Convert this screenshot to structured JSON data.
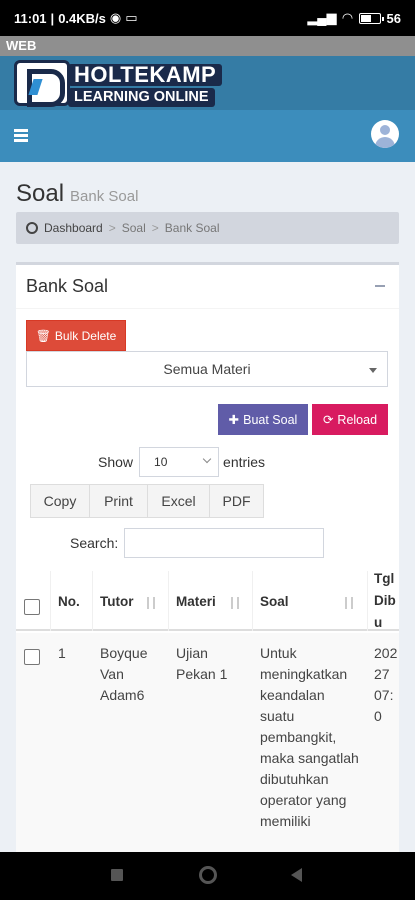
{
  "status_bar": {
    "time": "11:01",
    "speed": "0.4KB/s",
    "battery": "56",
    "battery_level": 0.56
  },
  "web_label": "WEB",
  "brand": {
    "line1": "HOLTEKAMP",
    "line2": "LEARNING ONLINE"
  },
  "header": {
    "title": "Soal",
    "subtitle": "Bank Soal"
  },
  "breadcrumb": {
    "items": [
      "Dashboard",
      "Soal",
      "Bank Soal"
    ]
  },
  "box": {
    "title": "Bank Soal",
    "bulk_delete": "Bulk Delete",
    "materi_select": "Semua Materi",
    "buat_soal": "Buat Soal",
    "reload": "Reload"
  },
  "datatable": {
    "show_label": "Show",
    "length_value": "10",
    "entries_label": "entries",
    "buttons": [
      "Copy",
      "Print",
      "Excel",
      "PDF"
    ],
    "search_label": "Search:",
    "columns": [
      "No.",
      "Tutor",
      "Materi",
      "Soal",
      "Tgl Dibu"
    ],
    "rows": [
      {
        "no": "1",
        "tutor": "Boyque Van Adam6",
        "materi": "Ujian Pekan 1",
        "soal": "Untuk meningkatkan keandalan suatu pembangkit, maka sangatlah dibutuhkan operator yang memiliki",
        "tgl": "202 27 07:0"
      }
    ]
  },
  "colors": {
    "navbar": "#3c8dbc",
    "brand_bar": "#357ca5",
    "danger": "#dd4b39",
    "purple": "#605ca8",
    "maroon": "#d81b60"
  }
}
